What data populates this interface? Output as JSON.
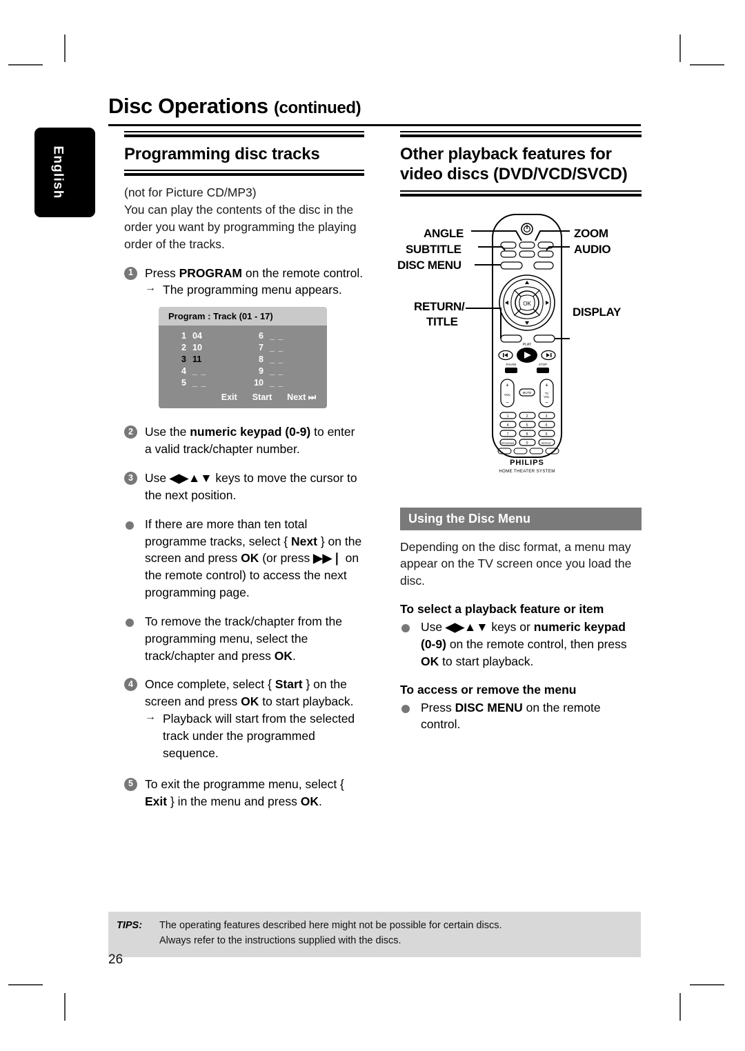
{
  "page": {
    "title": "Disc Operations",
    "title_suffix": "(continued)",
    "language_tab": "English",
    "page_number": "26"
  },
  "left_column": {
    "heading": "Programming disc tracks",
    "intro": [
      "(not for Picture CD/MP3)",
      "You can play the contents of the disc in the order you want by programming the playing order of the tracks."
    ],
    "step1": {
      "num": "1",
      "text_before": "Press ",
      "bold": "PROGRAM",
      "text_after": " on the remote control.",
      "result_arrow": "→",
      "result": "The programming menu appears."
    },
    "osd": {
      "header": "Program : Track (01 - 17)",
      "entries": [
        {
          "index": "1",
          "value": "04",
          "selected": false
        },
        {
          "index": "6",
          "value": "_ _",
          "selected": false
        },
        {
          "index": "2",
          "value": "10",
          "selected": false
        },
        {
          "index": "7",
          "value": "_ _",
          "selected": false
        },
        {
          "index": "3",
          "value": "11",
          "selected": true
        },
        {
          "index": "8",
          "value": "_ _",
          "selected": false
        },
        {
          "index": "4",
          "value": "_ _",
          "selected": false
        },
        {
          "index": "9",
          "value": "_ _",
          "selected": false
        },
        {
          "index": "5",
          "value": "_ _",
          "selected": false
        },
        {
          "index": "10",
          "value": "_ _",
          "selected": false
        }
      ],
      "buttons": [
        "Exit",
        "Start",
        "Next ⏭"
      ]
    },
    "step2": {
      "num": "2",
      "text_before": "Use the ",
      "bold": "numeric keypad (0-9)",
      "text_after": " to enter a valid track/chapter number."
    },
    "step3": {
      "num": "3",
      "text_before": "Use ",
      "keys": "◀▶▲▼",
      "text_after": " keys to move the cursor to the next position."
    },
    "bullet1": {
      "p1": "If there are more than ten total programme tracks, select { ",
      "b1": "Next",
      "p2": " } on the screen and press ",
      "b2": "OK",
      "p3": " (or press ",
      "icon": "▶▶❘",
      "p4": " on the remote control) to access the next programming page."
    },
    "bullet2": {
      "p1": "To remove the track/chapter from the programming menu, select the track/chapter and press ",
      "b1": "OK",
      "p2": "."
    },
    "step4": {
      "num": "4",
      "p1": "Once complete, select { ",
      "b1": "Start",
      "p2": " } on the screen and press ",
      "b2": "OK",
      "p3": " to start playback.",
      "result_arrow": "→",
      "result": "Playback will start from the selected track under the programmed sequence."
    },
    "step5": {
      "num": "5",
      "p1": "To exit the programme menu, select { ",
      "b1": "Exit",
      "p2": " } in the menu and press ",
      "b2": "OK",
      "p3": "."
    }
  },
  "right_column": {
    "heading": "Other playback features for video discs (DVD/VCD/SVCD)",
    "remote_labels": {
      "left": [
        "ANGLE",
        "SUBTITLE",
        "DISC MENU",
        "RETURN/",
        "TITLE"
      ],
      "right": [
        "ZOOM",
        "AUDIO",
        "DISPLAY"
      ],
      "brand": "PHILIPS",
      "brand_sub": "HOME THEATER SYSTEM",
      "ok_label": "OK",
      "play_label": "PLAY",
      "pause_label": "PAUSE",
      "stop_label": "STOP",
      "mute_label": "MUTE",
      "vol_label": "VOL",
      "tv_label": "TV VOL"
    },
    "disc_menu_section": {
      "bar_title": "Using the Disc Menu",
      "intro": "Depending on the disc format, a menu may appear on the TV screen once you load the disc.",
      "sub1": "To select a playback feature or item",
      "bullet1": {
        "p1": "Use ",
        "keys": "◀▶▲▼",
        "p2": " keys or ",
        "b1": "numeric keypad (0-9)",
        "p3": " on the remote control, then press ",
        "b2": "OK",
        "p4": " to start playback."
      },
      "sub2": "To access or remove the menu",
      "bullet2": {
        "p1": "Press ",
        "b1": "DISC MENU",
        "p2": " on the remote control."
      }
    }
  },
  "footer": {
    "tips_label": "TIPS:",
    "tips_line1": "The operating features described here might not be possible for certain discs.",
    "tips_line2": "Always refer to the instructions supplied with the discs."
  }
}
